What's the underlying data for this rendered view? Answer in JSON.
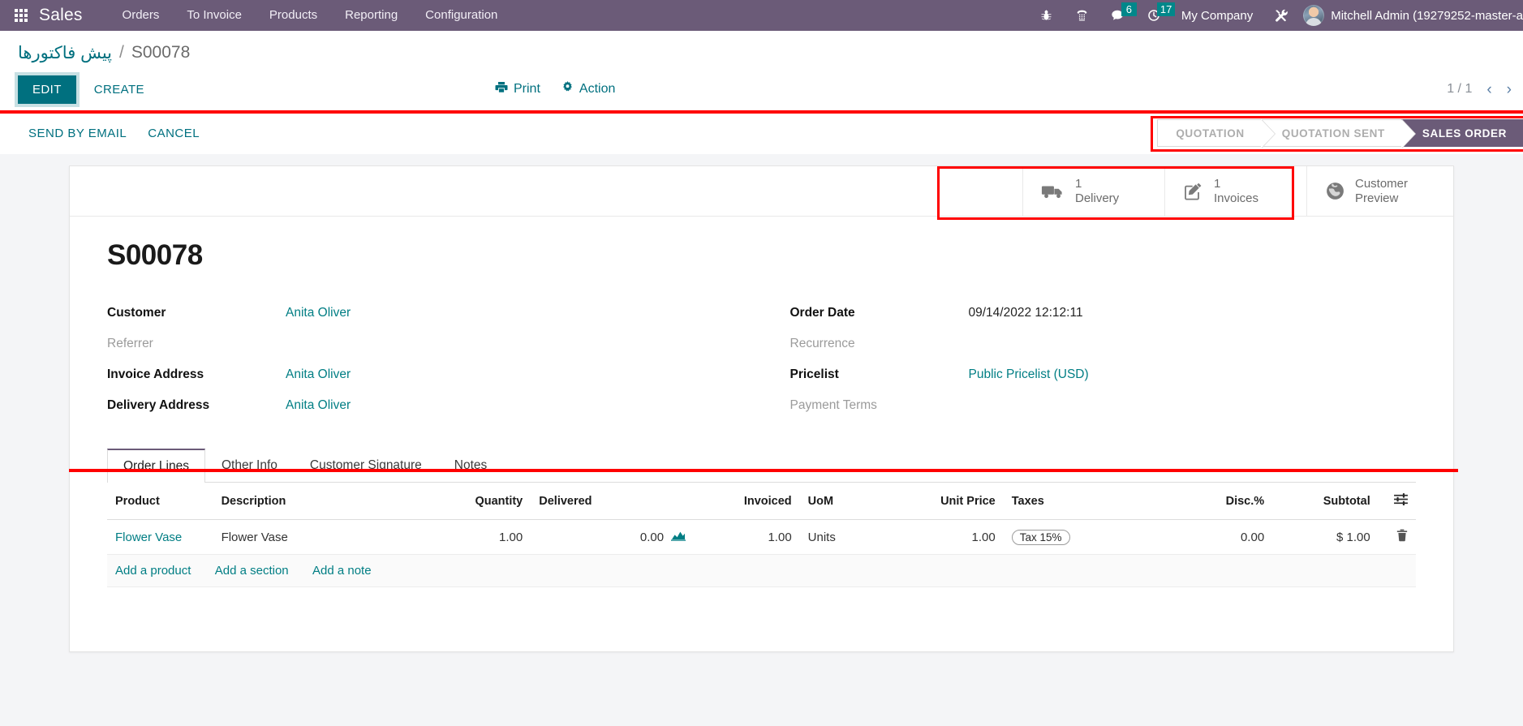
{
  "navbar": {
    "apps_icon": "apps-grid-icon",
    "brand": "Sales",
    "menu": [
      "Orders",
      "To Invoice",
      "Products",
      "Reporting",
      "Configuration"
    ],
    "sys_icons": [
      {
        "name": "bug-icon",
        "badge": null
      },
      {
        "name": "phone-icon",
        "badge": null
      },
      {
        "name": "messages-icon",
        "badge": "6"
      },
      {
        "name": "activities-clock-icon",
        "badge": "17"
      }
    ],
    "company": "My Company",
    "tools_icon": "wrench-screwdriver-icon",
    "avatar": "user-avatar",
    "user": "Mitchell Admin (19279252-master-a"
  },
  "breadcrumb": {
    "parent": "پیش فاکتورها",
    "separator": "/",
    "current": "S00078"
  },
  "control_panel": {
    "edit": "EDIT",
    "create": "CREATE",
    "print": "Print",
    "action": "Action",
    "pager_count": "1 / 1",
    "prev": "‹",
    "next": "›"
  },
  "statusbar": {
    "send_by_email": "SEND BY EMAIL",
    "cancel": "CANCEL",
    "stages": [
      {
        "label": "QUOTATION",
        "active": false
      },
      {
        "label": "QUOTATION SENT",
        "active": false
      },
      {
        "label": "SALES ORDER",
        "active": true
      }
    ]
  },
  "smart_buttons": [
    {
      "icon": "truck-icon",
      "value": "1",
      "label": "Delivery"
    },
    {
      "icon": "pencil-square-icon",
      "value": "1",
      "label": "Invoices"
    },
    {
      "icon": "globe-icon",
      "value": "Customer",
      "label": "Preview"
    }
  ],
  "record": {
    "title": "S00078",
    "left_fields": [
      {
        "label": "Customer",
        "value": "Anita Oliver",
        "link": true,
        "empty": false
      },
      {
        "label": "Referrer",
        "value": "",
        "link": false,
        "empty": true
      },
      {
        "label": "Invoice Address",
        "value": "Anita Oliver",
        "link": true,
        "empty": false
      },
      {
        "label": "Delivery Address",
        "value": "Anita Oliver",
        "link": true,
        "empty": false
      }
    ],
    "right_fields": [
      {
        "label": "Order Date",
        "value": "09/14/2022 12:12:11",
        "link": false,
        "empty": false
      },
      {
        "label": "Recurrence",
        "value": "",
        "link": false,
        "empty": true
      },
      {
        "label": "Pricelist",
        "value": "Public Pricelist (USD)",
        "link": true,
        "empty": false
      },
      {
        "label": "Payment Terms",
        "value": "",
        "link": false,
        "empty": true
      }
    ]
  },
  "tabs": [
    {
      "label": "Order Lines",
      "active": true
    },
    {
      "label": "Other Info",
      "active": false
    },
    {
      "label": "Customer Signature",
      "active": false
    },
    {
      "label": "Notes",
      "active": false
    }
  ],
  "order_lines": {
    "columns": [
      "Product",
      "Description",
      "Quantity",
      "Delivered",
      "Invoiced",
      "UoM",
      "Unit Price",
      "Taxes",
      "Disc.%",
      "Subtotal"
    ],
    "options_icon": "column-options-icon",
    "rows": [
      {
        "product": "Flower Vase",
        "description": "Flower Vase",
        "quantity": "1.00",
        "delivered": "0.00",
        "delivered_icon": "sparkline-icon",
        "invoiced": "1.00",
        "uom": "Units",
        "unit_price": "1.00",
        "taxes": "Tax 15%",
        "disc": "0.00",
        "subtotal": "$ 1.00",
        "delete_icon": "trash-icon"
      }
    ],
    "add_links": [
      "Add a product",
      "Add a section",
      "Add a note"
    ]
  },
  "colors": {
    "brand_purple": "#6b5b78",
    "accent_teal": "#00707f",
    "link_teal": "#017e84",
    "badge_teal": "#00878a",
    "annotation_red": "#ff0000"
  }
}
